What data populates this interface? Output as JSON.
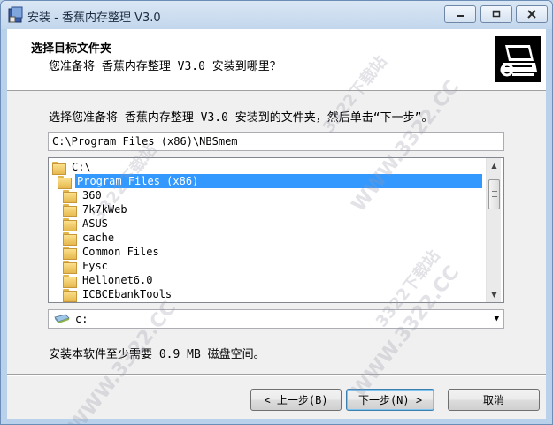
{
  "window": {
    "title": "安装 - 香蕉内存整理 V3.0"
  },
  "titlebar": {
    "min_icon": "minimize-icon",
    "max_icon": "maximize-icon",
    "close_icon": "close-icon"
  },
  "header": {
    "title": "选择目标文件夹",
    "subtitle": "您准备将 香蕉内存整理 V3.0 安装到哪里？"
  },
  "prompt": "选择您准备将 香蕉内存整理 V3.0 安装到的文件夹，然后单击“下一步”。",
  "path_input": {
    "value": "C:\\Program Files (x86)\\NBSmem"
  },
  "folder_tree": {
    "items": [
      {
        "label": "C:\\",
        "level": 0,
        "selected": false
      },
      {
        "label": "Program Files (x86)",
        "level": 1,
        "selected": true
      },
      {
        "label": "360",
        "level": 2,
        "selected": false
      },
      {
        "label": "7k7kWeb",
        "level": 2,
        "selected": false
      },
      {
        "label": "ASUS",
        "level": 2,
        "selected": false
      },
      {
        "label": "cache",
        "level": 2,
        "selected": false
      },
      {
        "label": "Common Files",
        "level": 2,
        "selected": false
      },
      {
        "label": "Fysc",
        "level": 2,
        "selected": false
      },
      {
        "label": "Hellonet6.0",
        "level": 2,
        "selected": false
      },
      {
        "label": "ICBCEbankTools",
        "level": 2,
        "selected": false
      },
      {
        "label": "",
        "level": 2,
        "selected": false
      }
    ]
  },
  "drive_select": {
    "value": "c:"
  },
  "space_text": "安装本软件至少需要 0.9 MB 磁盘空间。",
  "buttons": {
    "back": "< 上一步(B)",
    "next": "下一步(N) >",
    "cancel": "取消"
  },
  "watermark": {
    "url": "WWW.3322.CC",
    "site": "3322下载站"
  },
  "colors": {
    "selection": "#3399ff",
    "header_bg": "#ffffff",
    "body_bg": "#f0f0f0",
    "frame": "#b9d1ea"
  }
}
